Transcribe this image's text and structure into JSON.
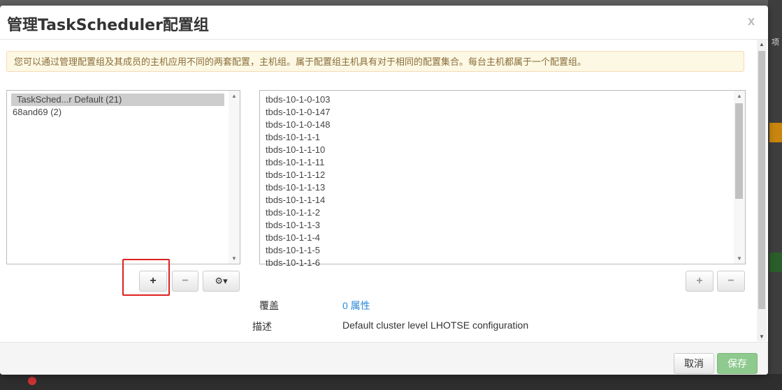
{
  "backdrop": {
    "side_text": "项"
  },
  "modal": {
    "title": "管理TaskScheduler配置组",
    "close_label": "x",
    "info_text": "您可以通过管理配置组及其成员的主机应用不同的两套配置，主机组。属于配置组主机具有对于相同的配置集合。每台主机都属于一个配置组。"
  },
  "groups": {
    "items": [
      {
        "label": "TaskSched...r Default (21)",
        "selected": true
      },
      {
        "label": "68and69 (2)",
        "selected": false
      }
    ],
    "add_label": "+",
    "remove_label": "−",
    "settings_caret": "▾"
  },
  "hosts": {
    "items": [
      "tbds-10-1-0-103",
      "tbds-10-1-0-147",
      "tbds-10-1-0-148",
      "tbds-10-1-1-1",
      "tbds-10-1-1-10",
      "tbds-10-1-1-11",
      "tbds-10-1-1-12",
      "tbds-10-1-1-13",
      "tbds-10-1-1-14",
      "tbds-10-1-1-2",
      "tbds-10-1-1-3",
      "tbds-10-1-1-4",
      "tbds-10-1-1-5",
      "tbds-10-1-1-6"
    ],
    "add_label": "+",
    "remove_label": "−"
  },
  "properties": {
    "overrides_label": "覆盖",
    "overrides_value": "0 属性",
    "description_label": "描述",
    "description_value": "Default cluster level LHOTSE configuration"
  },
  "footer": {
    "cancel_label": "取消",
    "save_label": "保存"
  },
  "colors": {
    "alert_bg": "#fcf8e3",
    "link": "#2b8ad8",
    "save_button": "#8ec98e",
    "highlight_box": "#e02020"
  }
}
